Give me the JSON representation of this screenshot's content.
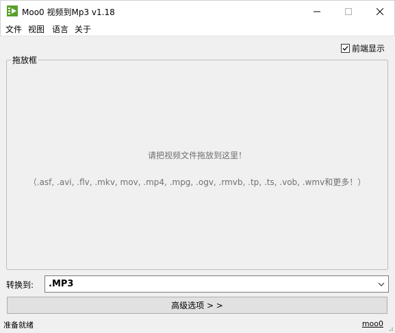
{
  "window": {
    "title": "Moo0 视频到Mp3 v1.18",
    "controls": [
      "minimize-icon",
      "maximize-icon",
      "close-icon"
    ]
  },
  "menu": {
    "items": [
      "文件",
      "视图",
      "语言",
      "关于"
    ]
  },
  "topmost": {
    "label": "前端显示",
    "checked": true
  },
  "drop_area": {
    "group_label": "拖放框",
    "hint": "请把视频文件拖放到这里！",
    "formats": "（.asf, .avi, .flv, .mkv, mov, .mp4, .mpg, .ogv, .rmvb, .tp, .ts, .vob, .wmv和更多！）"
  },
  "convert": {
    "label": "转换到:",
    "selected": ".MP3"
  },
  "advanced_button": "高级选项 > >",
  "status": {
    "text": "准备就绪",
    "link": "moo0"
  },
  "colors": {
    "hint_text": "#707070",
    "app_icon_green": "#5aa02c"
  }
}
